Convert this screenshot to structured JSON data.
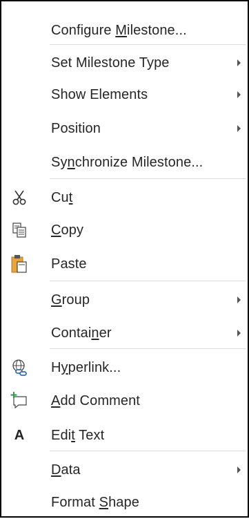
{
  "menu": {
    "items": [
      {
        "pre": "Configure ",
        "u": "M",
        "post": "ilestone...",
        "submenu": false
      },
      {
        "pre": "Set Milestone Type",
        "u": "",
        "post": "",
        "submenu": true
      },
      {
        "pre": "Show Elements",
        "u": "",
        "post": "",
        "submenu": true
      },
      {
        "pre": "Position",
        "u": "",
        "post": "",
        "submenu": true
      },
      {
        "pre": "Sy",
        "u": "n",
        "post": "chronize Milestone...",
        "submenu": false
      },
      {
        "pre": "Cu",
        "u": "t",
        "post": "",
        "submenu": false,
        "icon": "scissors-icon"
      },
      {
        "pre": "",
        "u": "C",
        "post": "opy",
        "submenu": false,
        "icon": "copy-icon"
      },
      {
        "pre": "Paste",
        "u": "",
        "post": "",
        "submenu": false,
        "icon": "paste-icon"
      },
      {
        "pre": "",
        "u": "G",
        "post": "roup",
        "submenu": true
      },
      {
        "pre": "Contai",
        "u": "n",
        "post": "er",
        "submenu": true
      },
      {
        "pre": "H",
        "u": "y",
        "post": "perlink...",
        "submenu": false,
        "icon": "hyperlink-icon"
      },
      {
        "pre": "",
        "u": "A",
        "post": "dd Comment",
        "submenu": false,
        "icon": "add-comment-icon"
      },
      {
        "pre": "Edi",
        "u": "t",
        "post": " Text",
        "submenu": false,
        "icon": "edit-text-icon"
      },
      {
        "pre": "",
        "u": "D",
        "post": "ata",
        "submenu": true
      },
      {
        "pre": "Format ",
        "u": "S",
        "post": "hape",
        "submenu": false
      }
    ]
  },
  "icons": {
    "edit_text_glyph": "A"
  },
  "colors": {
    "text": "#262626",
    "separator": "#dcdcdc",
    "paste_clipboard": "#e8a33d"
  }
}
